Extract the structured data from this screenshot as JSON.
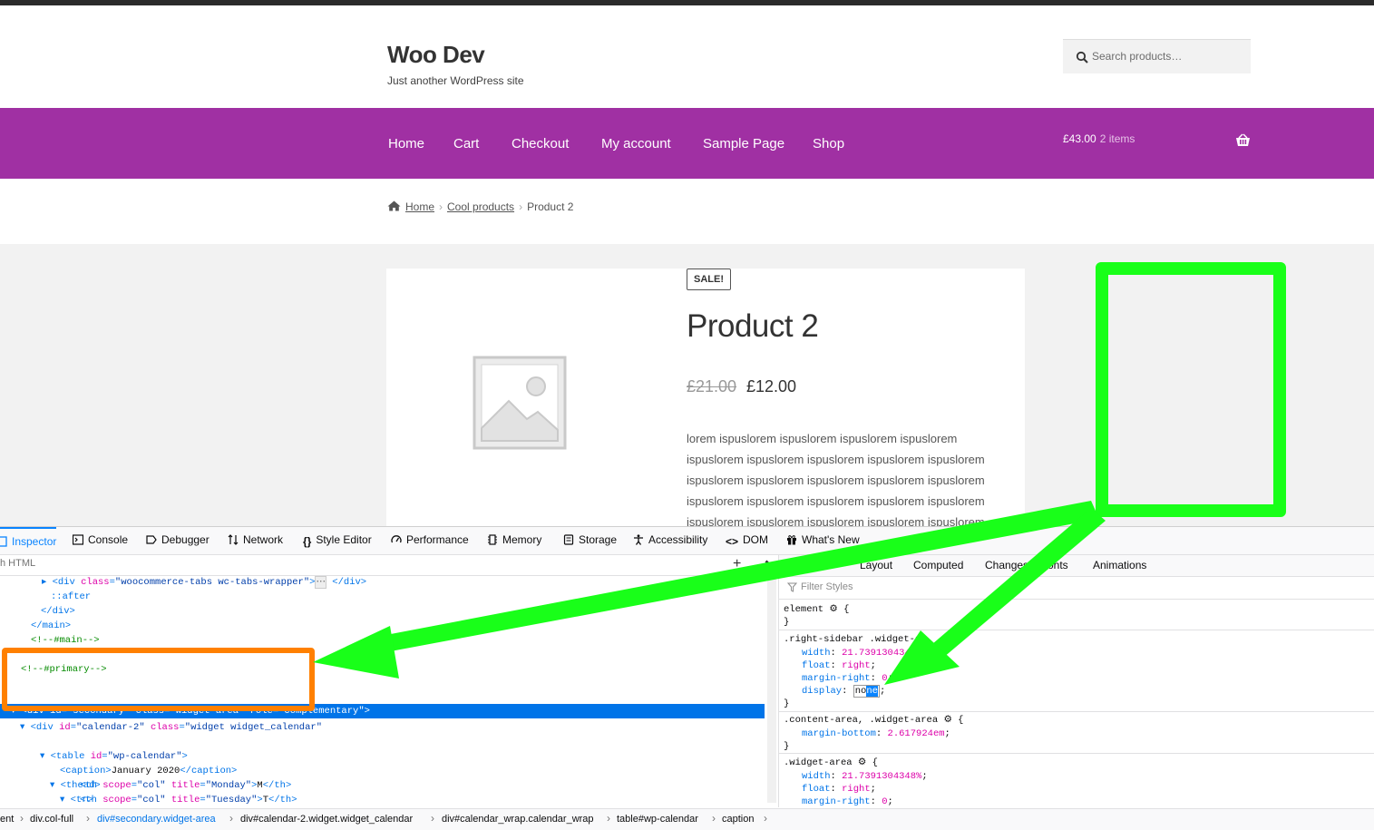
{
  "site": {
    "title": "Woo Dev",
    "tagline": "Just another WordPress site",
    "search_placeholder": "Search products…"
  },
  "nav": {
    "items": [
      "Home",
      "Cart",
      "Checkout",
      "My account",
      "Sample Page",
      "Shop"
    ],
    "cart_total": "£43.00",
    "cart_count": "2 items"
  },
  "breadcrumb": {
    "home": "Home",
    "category": "Cool products",
    "current": "Product 2"
  },
  "product": {
    "badge": "SALE!",
    "title": "Product 2",
    "old_price": "£21.00",
    "new_price": "£12.00",
    "description_lines": [
      "lorem ispuslorem ispuslorem ispuslorem ispuslorem",
      "ispuslorem ispuslorem ispuslorem ispuslorem ispuslorem",
      "ispuslorem ispuslorem ispuslorem ispuslorem ispuslorem",
      "ispuslorem ispuslorem ispuslorem ispuslorem ispuslorem",
      "ispuslorem ispuslorem ispuslorem ispuslorem ispuslorem"
    ]
  },
  "devtools": {
    "tabs": [
      "Inspector",
      "Console",
      "Debugger",
      "Network",
      "Style Editor",
      "Performance",
      "Memory",
      "Storage",
      "Accessibility",
      "DOM",
      "What's New"
    ],
    "search_html": "h HTML",
    "rules_tabs": [
      "es",
      "Layout",
      "Computed",
      "Changes",
      "onts",
      "Animations"
    ],
    "filter_placeholder": "Filter Styles",
    "markup": {
      "l1": {
        "open": "<div ",
        "attr": "class",
        "eq": "=",
        "val": "\"woocommerce-tabs wc-tabs-wrapper\"",
        "close": ">",
        "end": "</div>"
      },
      "l2": "::after",
      "l3": "</div>",
      "l4": "</main>",
      "l5": "<!--#main-->",
      "l6": "<!--#primary-->",
      "l7": "<div id=\"secondary\" class=\"widget-area\" role=\"complementary\">",
      "l8": {
        "open": "<div ",
        "a1": "id",
        "v1": "\"calendar-2\"",
        "a2": " class",
        "v2": "\"widget widget_calendar\""
      },
      "l9": {
        "open": "<table ",
        "a1": "id",
        "v1": "\"wp-calendar\"",
        "close": ">"
      },
      "l10": {
        "open": "<caption>",
        "text": "January 2020",
        "close": "</caption>"
      },
      "l11": "<thead>",
      "l12": "<tr>",
      "l13": {
        "open": "<th ",
        "a1": "scope",
        "v1": "\"col\"",
        "a2": " title",
        "v2": "\"Monday\"",
        "text": "M",
        "close": "</th>"
      },
      "l14": {
        "open": "<th ",
        "a1": "scope",
        "v1": "\"col\"",
        "a2": " title",
        "v2": "\"Tuesday\"",
        "text": "T",
        "close": "</th>"
      }
    },
    "rules": {
      "r1_sel": "element",
      "r2_sel": ".right-sidebar .widget-ar",
      "r2_width": "21.7391304348",
      "r2_float": "right",
      "r2_margin": "0",
      "r3_sel": ".content-area, .widget-area",
      "r3_margin": "2.617924em",
      "r4_sel": ".widget-area",
      "r4_width": "21.7391304348%",
      "r4_float": "right",
      "r4_margin": "0"
    },
    "statusbar": [
      "ent",
      "div.col-full",
      "div#secondary.widget-area",
      "div#calendar-2.widget.widget_calendar",
      "div#calendar_wrap.calendar_wrap",
      "table#wp-calendar",
      "caption"
    ]
  },
  "colors": {
    "nav_bg": "#a030a3",
    "annotation_green": "#19ff19",
    "annotation_orange": "#ff8000",
    "selection_blue": "#0074e8"
  }
}
